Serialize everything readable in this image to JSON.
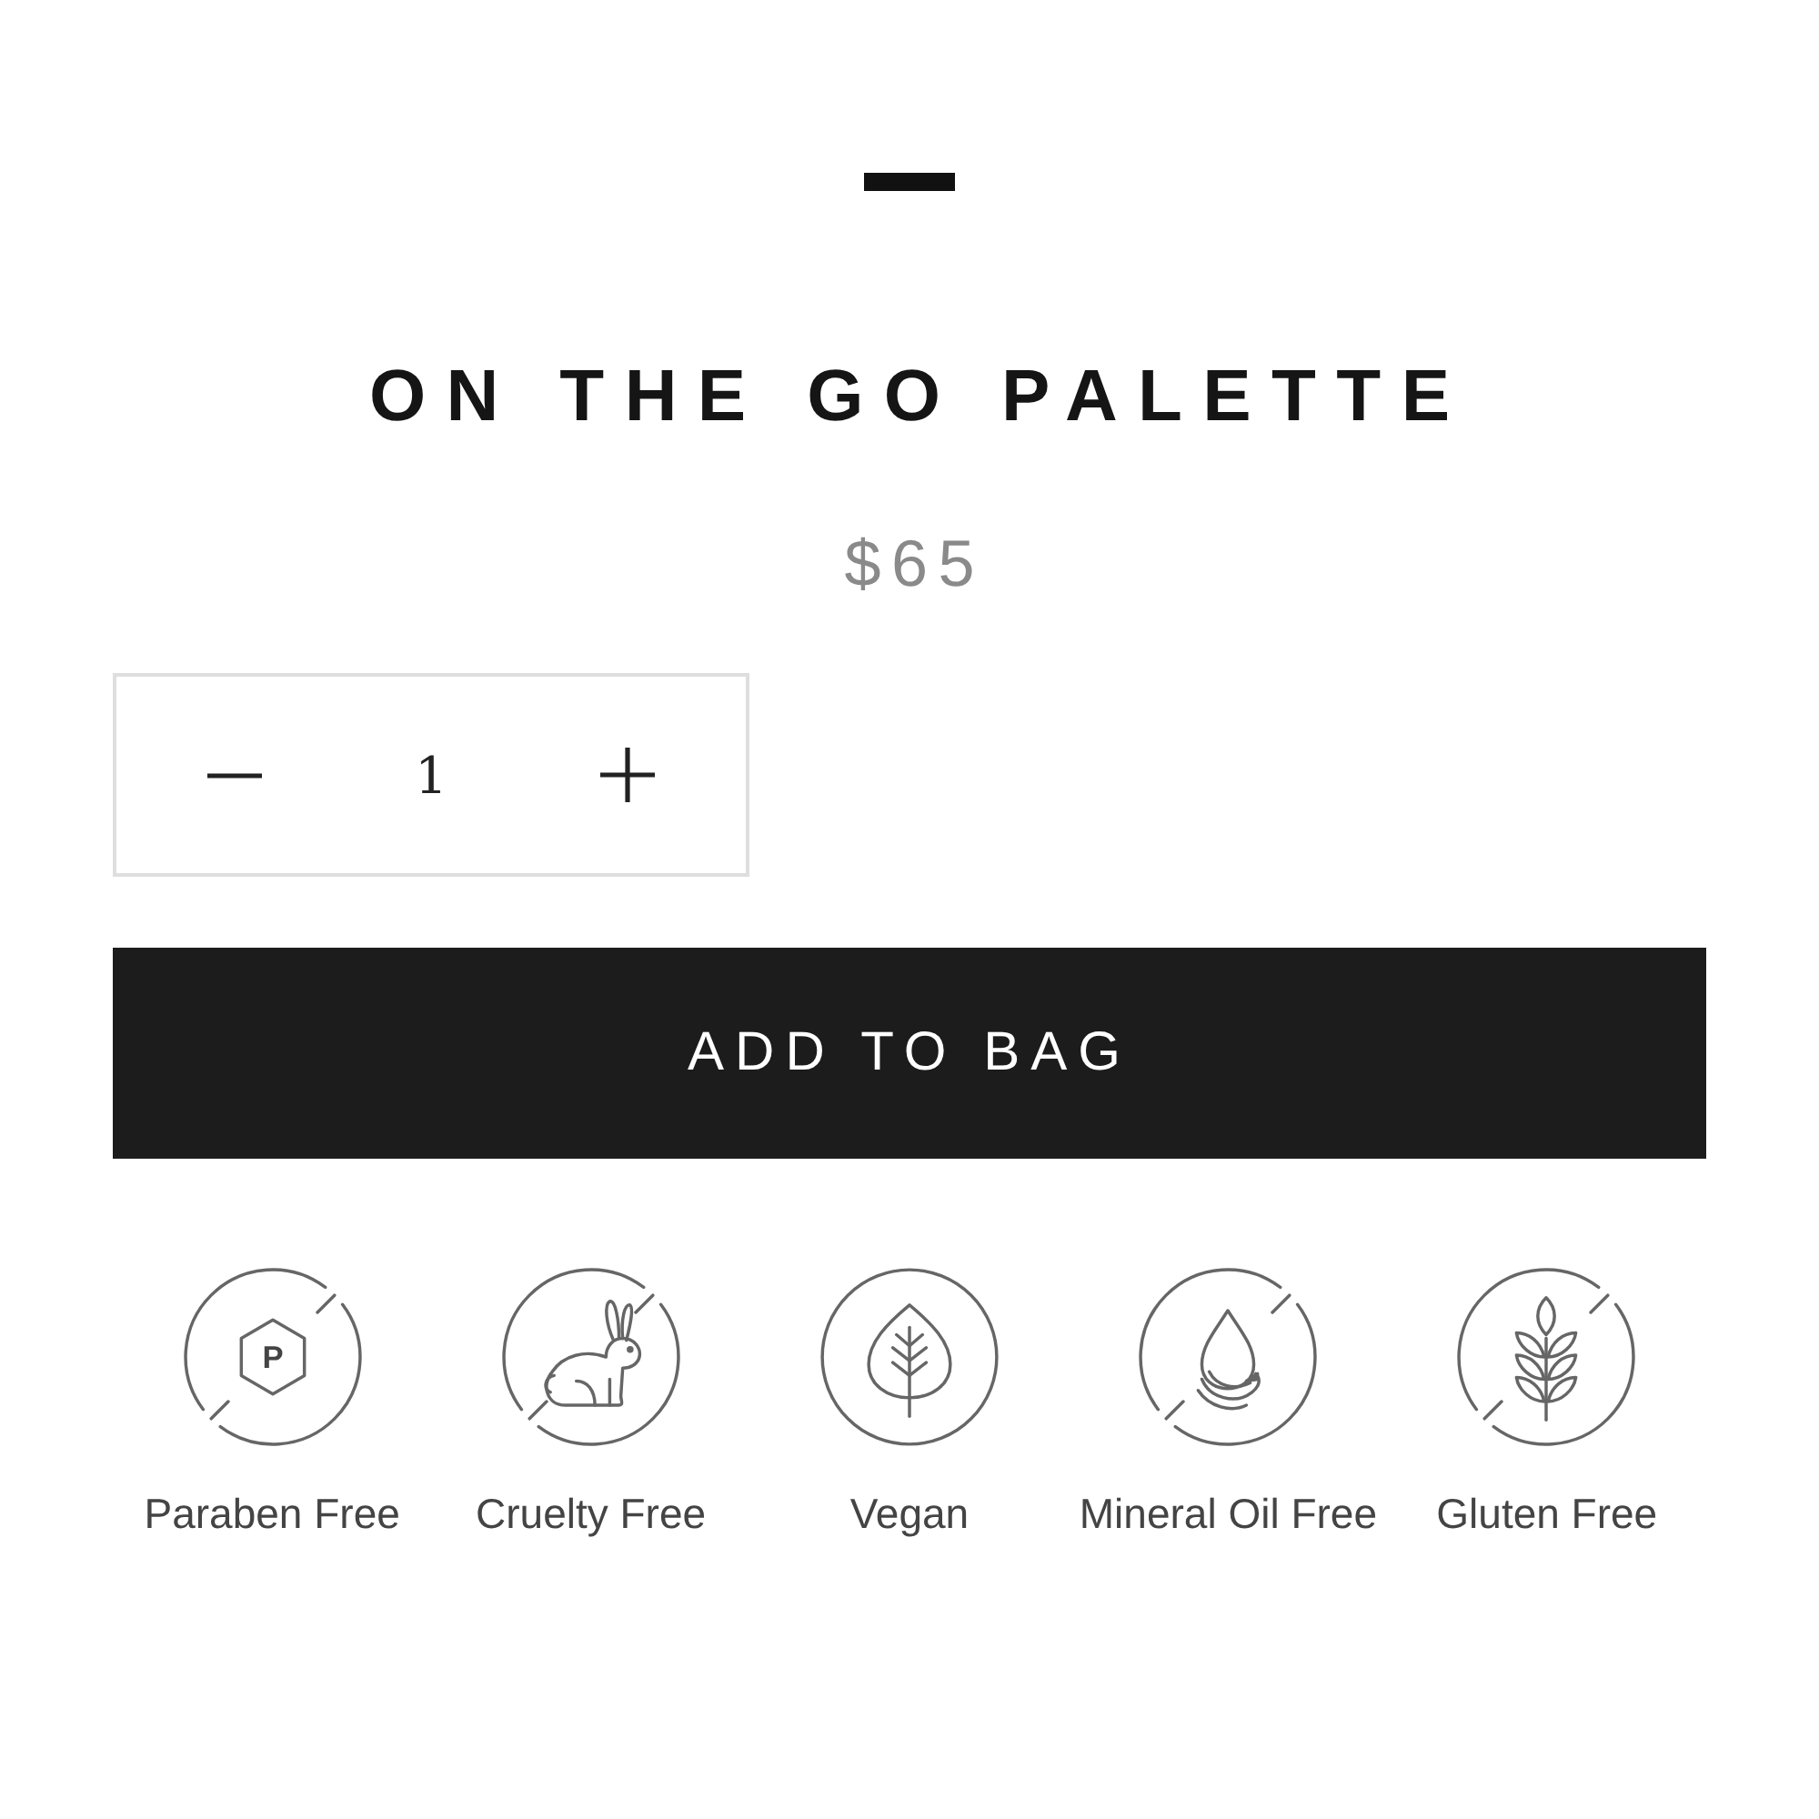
{
  "product": {
    "title": "ON THE GO PALETTE",
    "price": "$65"
  },
  "quantity": {
    "value": "1"
  },
  "add_button": {
    "label": "ADD TO BAG"
  },
  "badges": [
    {
      "label": "Paraben Free",
      "symbol": "P",
      "crossed": true
    },
    {
      "label": "Cruelty Free",
      "crossed": true
    },
    {
      "label": "Vegan",
      "crossed": false
    },
    {
      "label": "Mineral Oil Free",
      "crossed": true
    },
    {
      "label": "Gluten Free",
      "crossed": true
    }
  ]
}
